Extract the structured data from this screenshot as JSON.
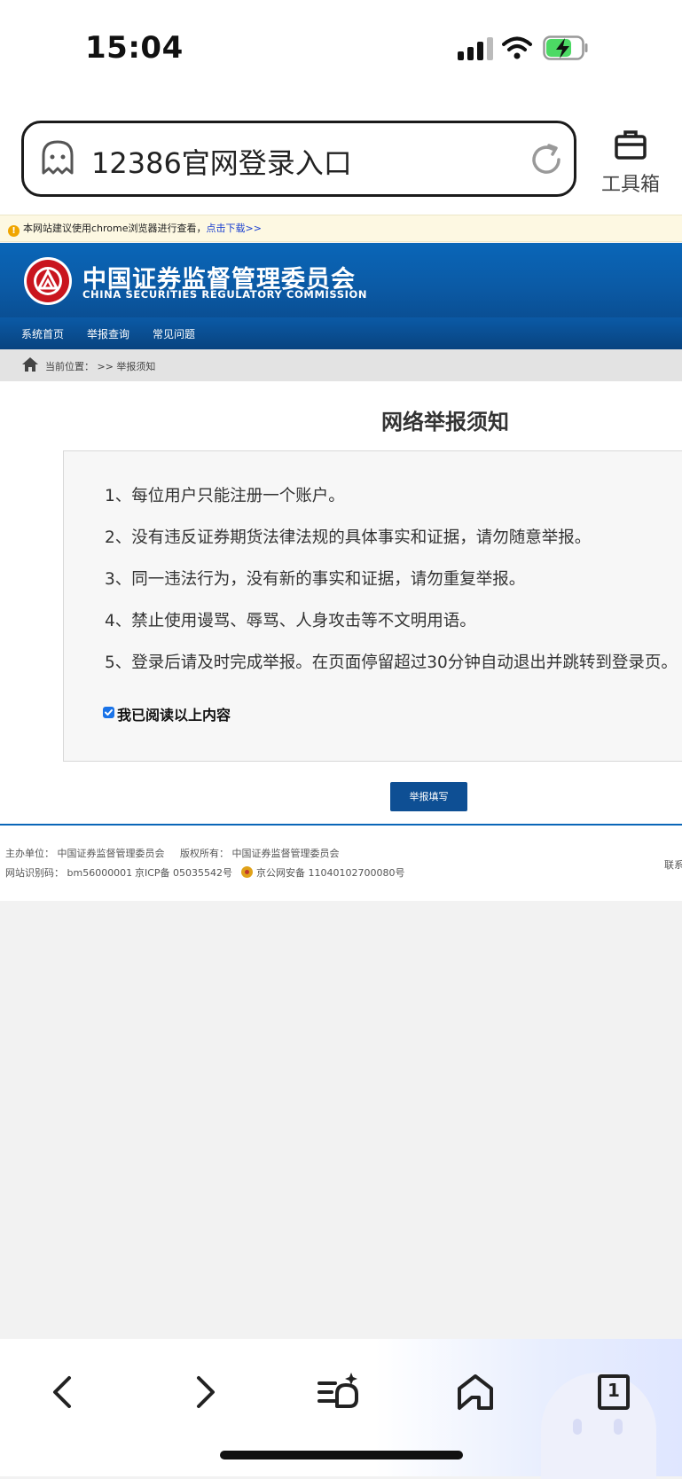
{
  "status_bar": {
    "time": "15:04"
  },
  "browser": {
    "url_text": "12386官网登录入口",
    "toolbox_label": "工具箱"
  },
  "notice_bar": {
    "text": "本网站建议使用chrome浏览器进行查看，",
    "link": "点击下载>>"
  },
  "header": {
    "org_name_cn": "中国证券监督管理委员会",
    "org_name_en": "CHINA SECURITIES REGULATORY COMMISSION"
  },
  "nav": {
    "items": [
      "系统首页",
      "举报查询",
      "常见问题"
    ]
  },
  "breadcrumb": {
    "text": "当前位置： >> 举报须知"
  },
  "main": {
    "title": "网络举报须知",
    "rules": [
      "1、每位用户只能注册一个账户。",
      "2、没有违反证券期货法律法规的具体事实和证据，请勿随意举报。",
      "3、同一违法行为，没有新的事实和证据，请勿重复举报。",
      "4、禁止使用谩骂、辱骂、人身攻击等不文明用语。",
      "5、登录后请及时完成举报。在页面停留超过30分钟自动退出并跳转到登录页。"
    ],
    "agree_label": "我已阅读以上内容",
    "agree_checked": true,
    "submit_label": "举报填写"
  },
  "footer": {
    "host": "主办单位： 中国证券监督管理委员会",
    "copyright": "版权所有： 中国证券监督管理委员会",
    "site_id": "网站识别码： bm56000001",
    "icp": "京ICP备 05035542号",
    "police": "京公网安备 11040102700080号",
    "contact": "联系"
  },
  "bottom_bar": {
    "tab_count": "1",
    "icons": [
      "back-icon",
      "forward-icon",
      "reading-list-icon",
      "home-icon",
      "tabs-icon"
    ]
  },
  "colors": {
    "brand_blue": "#0a66b8",
    "nav_blue": "#08437f",
    "button_blue": "#0e4f94",
    "notice_bg": "#fdf8e2"
  }
}
